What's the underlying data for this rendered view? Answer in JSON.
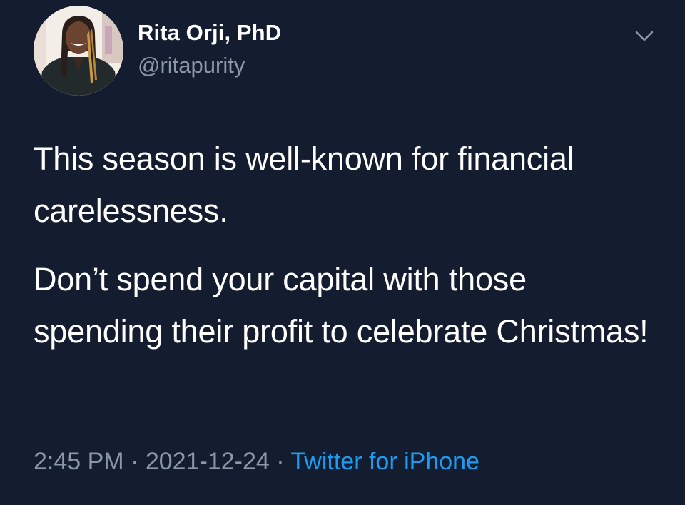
{
  "author": {
    "name": "Rita Orji, PhD",
    "handle": "@ritapurity"
  },
  "tweet": {
    "paragraphs": [
      "This season is well-known for financial carelessness.",
      "Don’t spend your capital with those spending their profit to celebrate Christmas!"
    ],
    "time": "2:45 PM",
    "separator": "·",
    "date": "2021-12-24",
    "source": "Twitter for iPhone"
  },
  "colors": {
    "background": "#141d2f",
    "text": "#ffffff",
    "secondary_text": "#8b98a5",
    "link": "#1d9bf0"
  },
  "icons": {
    "menu": "chevron-down-icon"
  }
}
